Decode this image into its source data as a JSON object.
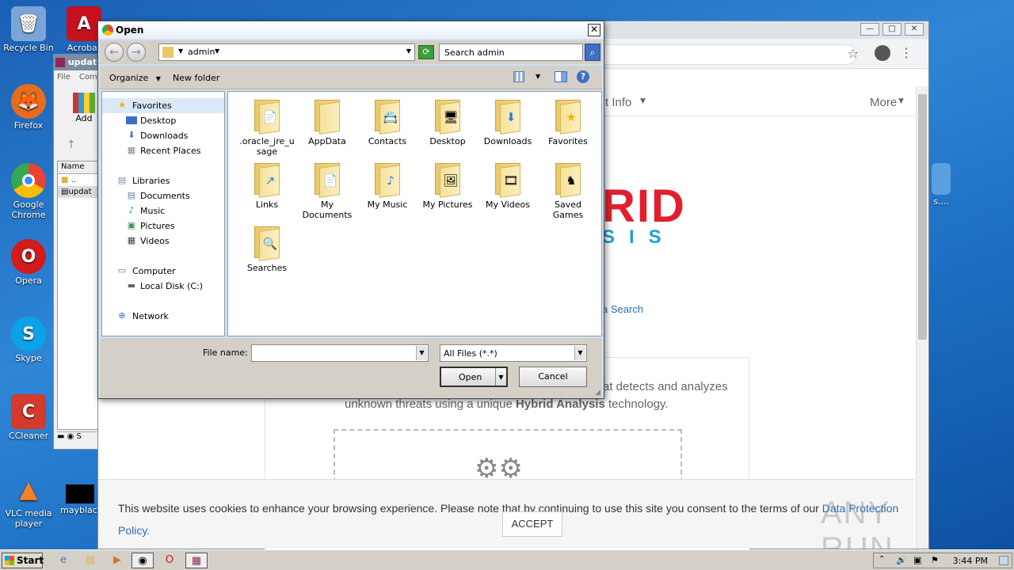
{
  "desktop": {
    "icons": [
      {
        "label": "Recycle Bin",
        "glyph": "🗑",
        "color": "#5a8fc9"
      },
      {
        "label": "Acrobat",
        "glyph": "A",
        "color": "#c8101f"
      },
      {
        "label": "Firefox",
        "glyph": "🦊",
        "color": "#e76d1c"
      },
      {
        "label": "Google Chrome",
        "glyph": "◉",
        "color": "#34a853"
      },
      {
        "label": "Opera",
        "glyph": "O",
        "color": "#d21b1b"
      },
      {
        "label": "Skype",
        "glyph": "S",
        "color": "#0aa3e8"
      },
      {
        "label": "CCleaner",
        "glyph": "C",
        "color": "#d43a2d"
      },
      {
        "label": "VLC media player",
        "glyph": "▲",
        "color": "#f58220"
      },
      {
        "label": "mayblack",
        "glyph": "",
        "color": "#000000"
      }
    ],
    "right_icon_label": "s...."
  },
  "winrar": {
    "title": "updat",
    "menu": [
      "File",
      "Com"
    ],
    "add_label": "Add",
    "col_name": "Name",
    "rows": [
      "..",
      "updat"
    ]
  },
  "browser": {
    "nav_partial": "t Info",
    "nav_more": "More",
    "logo_main": "RID",
    "logo_sub": "SIS",
    "search_link": "a Search",
    "desc_line1": "at detects and analyzes",
    "desc_line2_pre": "unknown threats using a unique ",
    "desc_line2_bold": "Hybrid Analysis",
    "desc_line2_post": " technology.",
    "cookie_text": "This website uses cookies to enhance your browsing experience. Please note that by continuing to use this site you consent to the terms of our",
    "cookie_link": "Data Protection Policy.",
    "accept_label": "ACCEPT",
    "watermark": "ANY RUN"
  },
  "dialog": {
    "title": "Open",
    "path_segment": "admin",
    "search_placeholder": "Search admin",
    "toolbar": {
      "organize": "Organize",
      "new_folder": "New folder"
    },
    "nav": {
      "favorites": "Favorites",
      "favorites_items": [
        "Desktop",
        "Downloads",
        "Recent Places"
      ],
      "libraries": "Libraries",
      "libraries_items": [
        "Documents",
        "Music",
        "Pictures",
        "Videos"
      ],
      "computer": "Computer",
      "computer_items": [
        "Local Disk (C:)"
      ],
      "network": "Network"
    },
    "files": [
      {
        "label": ".oracle_jre_usage",
        "glyph": "📄"
      },
      {
        "label": "AppData",
        "glyph": ""
      },
      {
        "label": "Contacts",
        "glyph": "📇"
      },
      {
        "label": "Desktop",
        "glyph": "🖥"
      },
      {
        "label": "Downloads",
        "glyph": "⬇"
      },
      {
        "label": "Favorites",
        "glyph": "★"
      },
      {
        "label": "Links",
        "glyph": "↗"
      },
      {
        "label": "My Documents",
        "glyph": "📄"
      },
      {
        "label": "My Music",
        "glyph": "♪"
      },
      {
        "label": "My Pictures",
        "glyph": "🖼"
      },
      {
        "label": "My Videos",
        "glyph": "🎞"
      },
      {
        "label": "Saved Games",
        "glyph": "♞"
      },
      {
        "label": "Searches",
        "glyph": "🔍"
      }
    ],
    "file_name_label": "File name:",
    "file_name_value": "",
    "filter_value": "All Files (*.*)",
    "open_label": "Open",
    "cancel_label": "Cancel"
  },
  "taskbar": {
    "start_label": "Start",
    "clock": "3:44 PM"
  }
}
